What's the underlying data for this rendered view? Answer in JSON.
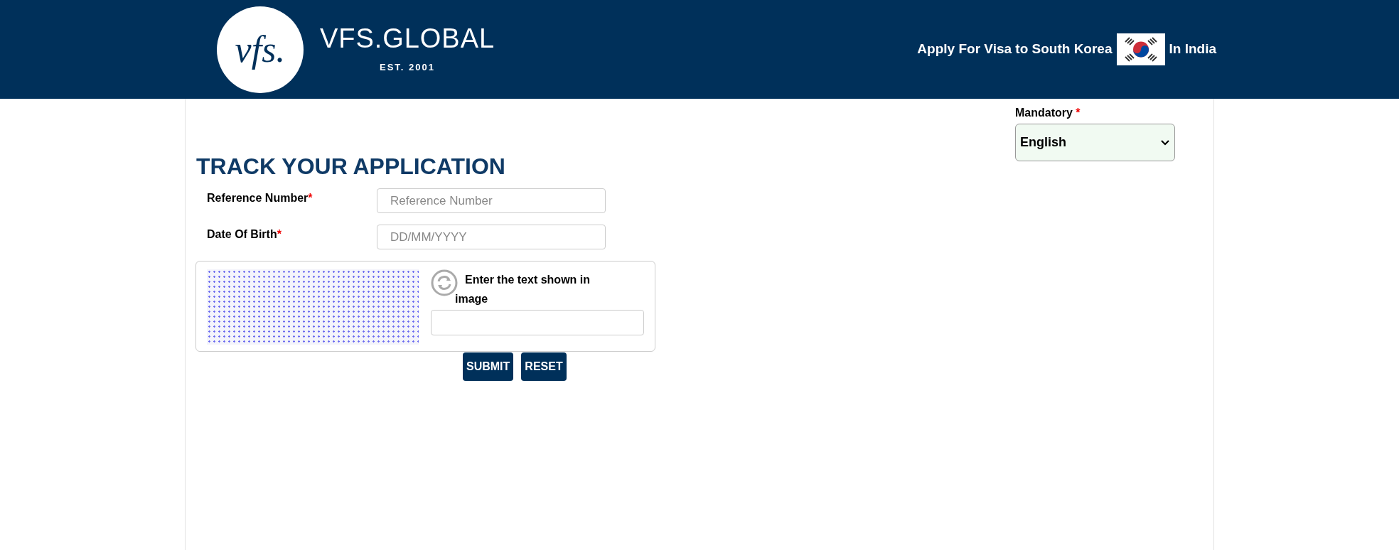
{
  "header": {
    "logo_mark": "vfs.",
    "brand": "VFS.GLOBAL",
    "established": "EST. 2001",
    "tagline_before_flag": "Apply For Visa to South Korea",
    "tagline_after_flag": "In India"
  },
  "language": {
    "label": "Mandatory",
    "required_mark": "*",
    "value": "English"
  },
  "title": "TRACK YOUR APPLICATION",
  "fields": [
    {
      "label": "Reference Number",
      "required_mark": "*",
      "placeholder": "Reference Number"
    },
    {
      "label": "Date Of Birth",
      "required_mark": "*",
      "placeholder": "DD/MM/YYYY"
    }
  ],
  "captcha": {
    "prompt": "Enter the text shown in image"
  },
  "buttons": [
    "SUBMIT",
    "RESET"
  ]
}
